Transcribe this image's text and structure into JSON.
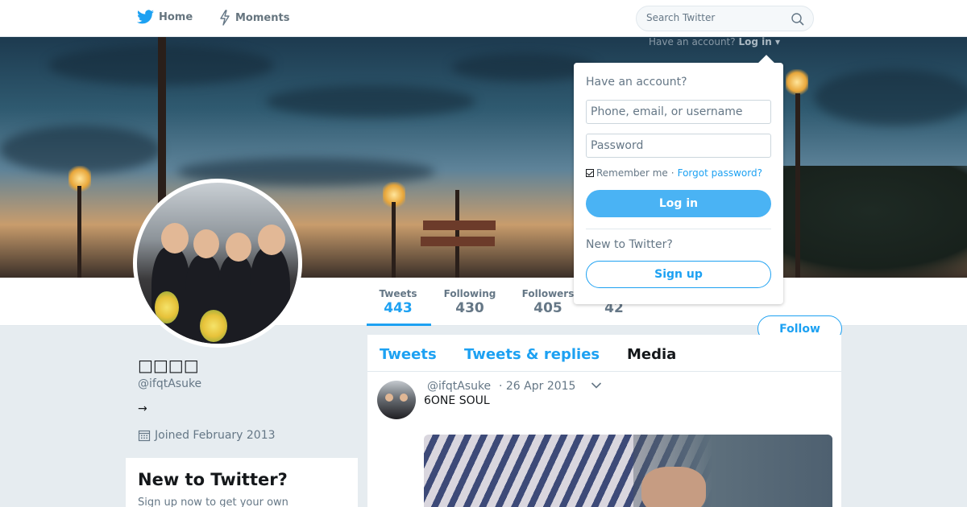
{
  "nav": {
    "home_label": "Home",
    "moments_label": "Moments",
    "search_placeholder": "Search Twitter"
  },
  "account_prompt": {
    "text": "Have an account?",
    "login_label": "Log in"
  },
  "profile": {
    "display_name": "□□□□",
    "handle": "@ifqtAsuke",
    "bio": "→",
    "joined": "Joined February 2013",
    "follow_label": "Follow"
  },
  "stats": {
    "tweets_label": "Tweets",
    "tweets_value": "443",
    "following_label": "Following",
    "following_value": "430",
    "followers_label": "Followers",
    "followers_value": "405",
    "likes_value": "42"
  },
  "timeline": {
    "tabs": [
      "Tweets",
      "Tweets & replies",
      "Media"
    ],
    "active_tab": "Media",
    "tweet": {
      "handle": "@ifqtAsuke",
      "date": "· 26 Apr 2015",
      "text": "6ONE SOUL"
    }
  },
  "signup_card": {
    "title": "New to Twitter?",
    "text": "Sign up now to get your own"
  },
  "login_dropdown": {
    "title": "Have an account?",
    "username_placeholder": "Phone, email, or username",
    "password_placeholder": "Password",
    "remember_label": "Remember me",
    "separator": "·",
    "forgot_label": "Forgot password?",
    "login_button": "Log in",
    "new_prompt": "New to Twitter?",
    "signup_button": "Sign up"
  },
  "colors": {
    "accent": "#1da1f2",
    "login_button": "#4ab3f4",
    "page_background": "#e6ecf0"
  }
}
